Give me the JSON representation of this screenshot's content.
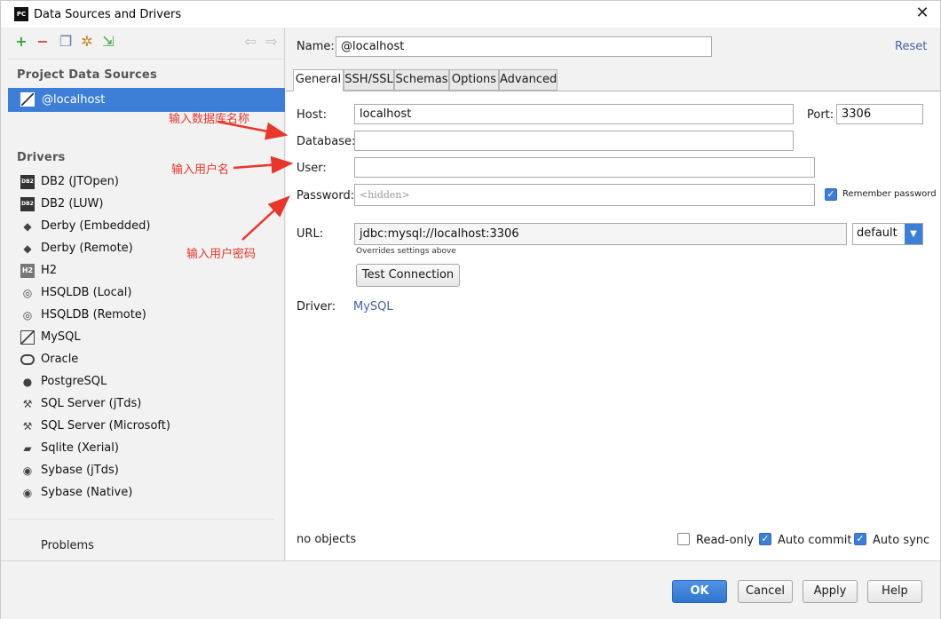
{
  "window": {
    "title": "Data Sources and Drivers",
    "app_icon": "PC"
  },
  "left": {
    "project_heading": "Project Data Sources",
    "selected_source": "@localhost",
    "drivers_heading": "Drivers",
    "drivers": [
      {
        "label": "DB2 (JTOpen)",
        "icon": "db2-icon"
      },
      {
        "label": "DB2 (LUW)",
        "icon": "db2-icon"
      },
      {
        "label": "Derby (Embedded)",
        "icon": "derby-hat-icon"
      },
      {
        "label": "Derby (Remote)",
        "icon": "derby-hat-icon"
      },
      {
        "label": "H2",
        "icon": "h2-icon"
      },
      {
        "label": "HSQLDB (Local)",
        "icon": "hsqldb-icon"
      },
      {
        "label": "HSQLDB (Remote)",
        "icon": "hsqldb-icon"
      },
      {
        "label": "MySQL",
        "icon": "mysql-icon"
      },
      {
        "label": "Oracle",
        "icon": "oracle-icon"
      },
      {
        "label": "PostgreSQL",
        "icon": "elephant-icon"
      },
      {
        "label": "SQL Server (jTds)",
        "icon": "sqlserver-icon"
      },
      {
        "label": "SQL Server (Microsoft)",
        "icon": "sqlserver-icon"
      },
      {
        "label": "Sqlite (Xerial)",
        "icon": "sqlite-icon"
      },
      {
        "label": "Sybase (jTds)",
        "icon": "sybase-icon"
      },
      {
        "label": "Sybase (Native)",
        "icon": "sybase-icon"
      }
    ],
    "problems": "Problems"
  },
  "form": {
    "name_label": "Name:",
    "name_value": "@localhost",
    "reset": "Reset",
    "tabs": [
      "General",
      "SSH/SSL",
      "Schemas",
      "Options",
      "Advanced"
    ],
    "host_label": "Host:",
    "host_value": "localhost",
    "port_label": "Port:",
    "port_value": "3306",
    "database_label": "Database:",
    "database_value": "",
    "user_label": "User:",
    "user_value": "",
    "password_label": "Password:",
    "password_placeholder": "<hidden>",
    "remember_password": "Remember password",
    "url_label": "URL:",
    "url_value": "jdbc:mysql://localhost:3306",
    "url_mode": "default",
    "overrides_note": "Overrides settings above",
    "test_connection": "Test Connection",
    "driver_label": "Driver:",
    "driver_value": "MySQL",
    "status": "no objects",
    "readonly": "Read-only",
    "autocommit": "Auto commit",
    "autosync": "Auto sync"
  },
  "buttons": {
    "ok": "OK",
    "cancel": "Cancel",
    "apply": "Apply",
    "help": "Help"
  },
  "annotations": {
    "database": "输入数据库名称",
    "user": "输入用户名",
    "password": "输入用户密码"
  },
  "colors": {
    "accent": "#3d7fd6",
    "annotation": "#e8362a",
    "link": "#4a5ea6"
  }
}
